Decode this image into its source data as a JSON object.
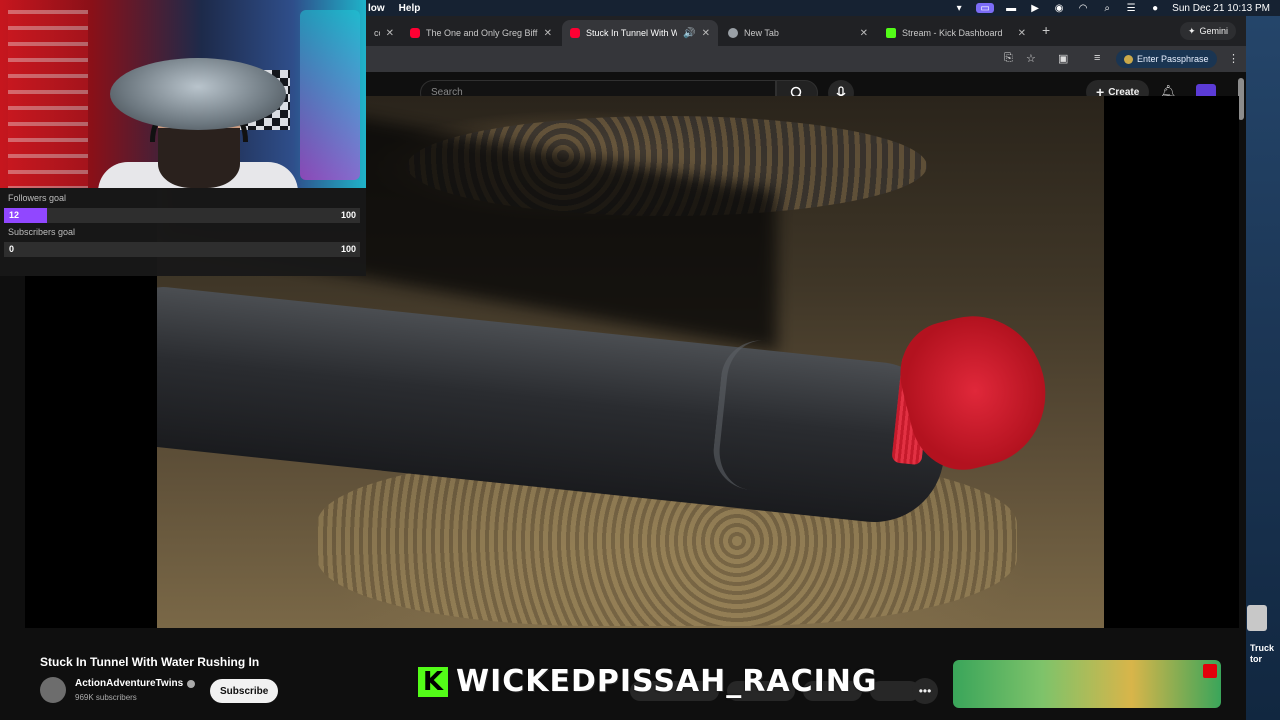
{
  "menubar": {
    "menus": [
      "low",
      "Help"
    ],
    "datetime": "Sun Dec 21  10:13 PM"
  },
  "tabs": [
    {
      "title": "co",
      "favicon": "youtube-icon",
      "state": "partial"
    },
    {
      "title": "The One and Only Greg Biffle",
      "favicon": "youtube-icon"
    },
    {
      "title": "Stuck In Tunnel With Wate",
      "favicon": "youtube-icon",
      "active": true,
      "audio": true
    },
    {
      "title": "New Tab",
      "favicon": "globe-icon"
    },
    {
      "title": "Stream - Kick Dashboard",
      "favicon": "kick-icon"
    }
  ],
  "toolbar": {
    "gemini_label": "Gemini",
    "passphrase_label": "Enter Passphrase"
  },
  "youtube": {
    "search_placeholder": "Search",
    "create_label": "Create",
    "video_title": "Stuck In Tunnel With Water Rushing In",
    "channel_name": "ActionAdventureTwins",
    "subscribers": "969K subscribers",
    "subscribe_label": "Subscribe"
  },
  "stream_overlay": {
    "followers_goal_label": "Followers goal",
    "followers_current": "12",
    "followers_target": "100",
    "followers_progress": 0.12,
    "subscribers_goal_label": "Subscribers goal",
    "subscribers_current": "0",
    "subscribers_target": "100",
    "subscribers_progress": 0.0,
    "banner_text": "WICKEDPISSAH_RACING"
  },
  "desktop": {
    "dock_label_1": "Truck",
    "dock_label_2": "tor"
  },
  "colors": {
    "kick_green": "#53fc18",
    "goal_purple": "#9147ff",
    "youtube_red": "#ff0033"
  }
}
